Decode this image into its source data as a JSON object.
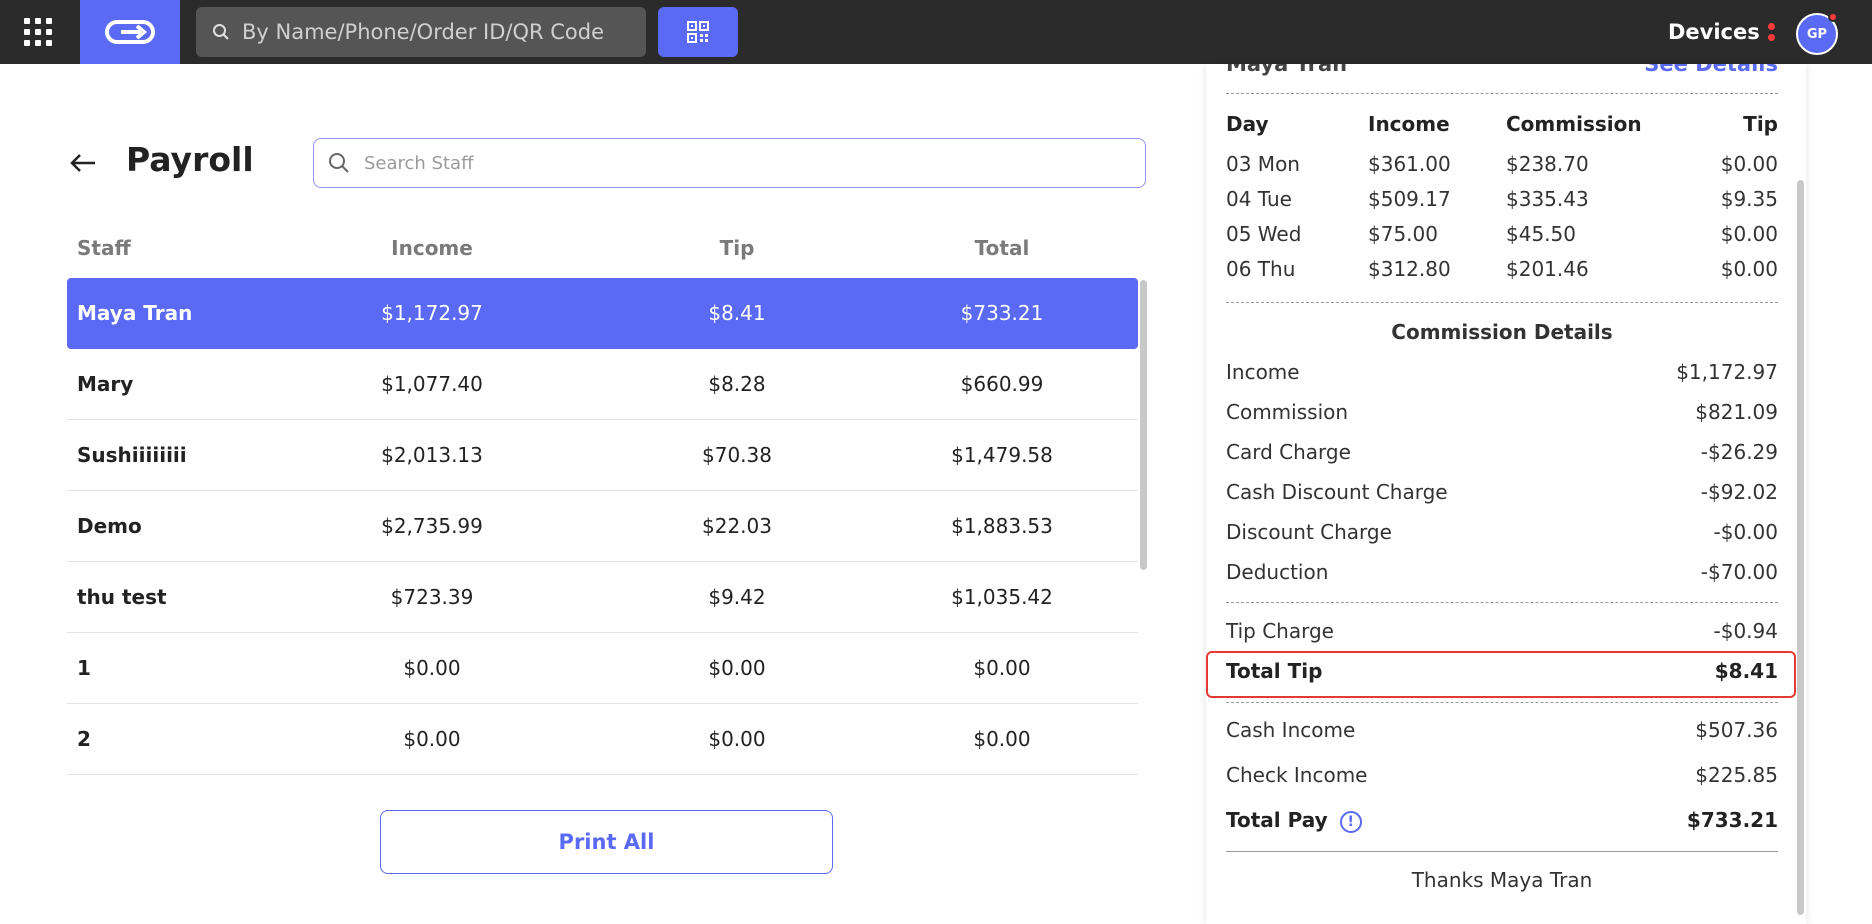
{
  "topbar": {
    "search_placeholder": "By Name/Phone/Order ID/QR Code",
    "devices_label": "Devices",
    "avatar_initials": "GP"
  },
  "page": {
    "title": "Payroll",
    "staff_search_placeholder": "Search Staff",
    "print_all_label": "Print All"
  },
  "table": {
    "headers": {
      "staff": "Staff",
      "income": "Income",
      "tip": "Tip",
      "total": "Total"
    },
    "rows": [
      {
        "name": "Maya Tran",
        "income": "$1,172.97",
        "tip": "$8.41",
        "total": "$733.21",
        "selected": true
      },
      {
        "name": "Mary",
        "income": "$1,077.40",
        "tip": "$8.28",
        "total": "$660.99"
      },
      {
        "name": "Sushiiiiiiii",
        "income": "$2,013.13",
        "tip": "$70.38",
        "total": "$1,479.58"
      },
      {
        "name": "Demo",
        "income": "$2,735.99",
        "tip": "$22.03",
        "total": "$1,883.53"
      },
      {
        "name": "thu test",
        "income": "$723.39",
        "tip": "$9.42",
        "total": "$1,035.42"
      },
      {
        "name": "1",
        "income": "$0.00",
        "tip": "$0.00",
        "total": "$0.00"
      },
      {
        "name": "2",
        "income": "$0.00",
        "tip": "$0.00",
        "total": "$0.00"
      }
    ]
  },
  "detail": {
    "staff_name": "Maya Tran",
    "see_details_label": "See Details",
    "day_headers": {
      "day": "Day",
      "income": "Income",
      "commission": "Commission",
      "tip": "Tip"
    },
    "days": [
      {
        "day": "03 Mon",
        "income": "$361.00",
        "commission": "$238.70",
        "tip": "$0.00"
      },
      {
        "day": "04 Tue",
        "income": "$509.17",
        "commission": "$335.43",
        "tip": "$9.35"
      },
      {
        "day": "05 Wed",
        "income": "$75.00",
        "commission": "$45.50",
        "tip": "$0.00"
      },
      {
        "day": "06 Thu",
        "income": "$312.80",
        "commission": "$201.46",
        "tip": "$0.00"
      }
    ],
    "commission_title": "Commission Details",
    "commission_items": [
      {
        "label": "Income",
        "value": "$1,172.97"
      },
      {
        "label": "Commission",
        "value": "$821.09"
      },
      {
        "label": "Card Charge",
        "value": "-$26.29"
      },
      {
        "label": "Cash Discount Charge",
        "value": "-$92.02"
      },
      {
        "label": "Discount Charge",
        "value": "-$0.00"
      },
      {
        "label": "Deduction",
        "value": "-$70.00"
      }
    ],
    "tip_charge": {
      "label": "Tip Charge",
      "value": "-$0.94"
    },
    "total_tip": {
      "label": "Total Tip",
      "value": "$8.41"
    },
    "cash_income": {
      "label": "Cash Income",
      "value": "$507.36"
    },
    "check_income": {
      "label": "Check Income",
      "value": "$225.85"
    },
    "total_pay": {
      "label": "Total Pay",
      "value": "$733.21"
    },
    "thanks": "Thanks Maya Tran"
  },
  "colors": {
    "accent": "#5a6af5",
    "topbar": "#2b2b2b",
    "alert": "#ff3b3b",
    "highlight_border": "#e53935"
  }
}
